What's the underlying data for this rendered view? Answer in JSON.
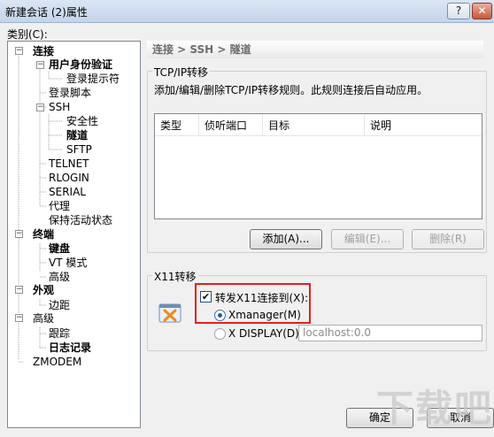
{
  "window": {
    "title": "新建会话 (2)属性",
    "help_label": "?",
    "close_label": "✕"
  },
  "category_label": "类别(C):",
  "tree": [
    {
      "label": "连接",
      "bold": true,
      "toggle": "−"
    },
    {
      "label": "用户身份验证",
      "bold": true,
      "toggle": "−"
    },
    {
      "label": "登录提示符",
      "bold": false
    },
    {
      "label": "登录脚本",
      "bold": false
    },
    {
      "label": "SSH",
      "bold": false,
      "toggle": "−"
    },
    {
      "label": "安全性",
      "bold": false
    },
    {
      "label": "隧道",
      "bold": true
    },
    {
      "label": "SFTP",
      "bold": false
    },
    {
      "label": "TELNET",
      "bold": false
    },
    {
      "label": "RLOGIN",
      "bold": false
    },
    {
      "label": "SERIAL",
      "bold": false
    },
    {
      "label": "代理",
      "bold": false
    },
    {
      "label": "保持活动状态",
      "bold": false
    },
    {
      "label": "终端",
      "bold": true,
      "toggle": "−"
    },
    {
      "label": "键盘",
      "bold": true
    },
    {
      "label": "VT 模式",
      "bold": false
    },
    {
      "label": "高级",
      "bold": false
    },
    {
      "label": "外观",
      "bold": true,
      "toggle": "−"
    },
    {
      "label": "边距",
      "bold": false
    },
    {
      "label": "高级",
      "bold": false,
      "toggle": "−"
    },
    {
      "label": "跟踪",
      "bold": false
    },
    {
      "label": "日志记录",
      "bold": true
    },
    {
      "label": "ZMODEM",
      "bold": false
    }
  ],
  "breadcrumb": "连接 > SSH > 隧道",
  "tcpip": {
    "title": "TCP/IP转移",
    "description": "添加/编辑/删除TCP/IP转移规则。此规则连接后自动应用。",
    "columns": [
      "类型",
      "侦听端口",
      "目标",
      "说明"
    ],
    "add_label": "添加(A)...",
    "edit_label": "编辑(E)...",
    "delete_label": "删除(R)"
  },
  "x11": {
    "title": "X11转移",
    "forward_label": "转发X11连接到(X):",
    "forward_checked": true,
    "xmanager_label": "Xmanager(M)",
    "xdisplay_label": "X DISPLAY(D):",
    "xdisplay_value": "localhost:0.0",
    "selected": "xmanager"
  },
  "footer": {
    "ok_label": "确定",
    "cancel_label": "取消"
  },
  "watermark": "下载吧"
}
